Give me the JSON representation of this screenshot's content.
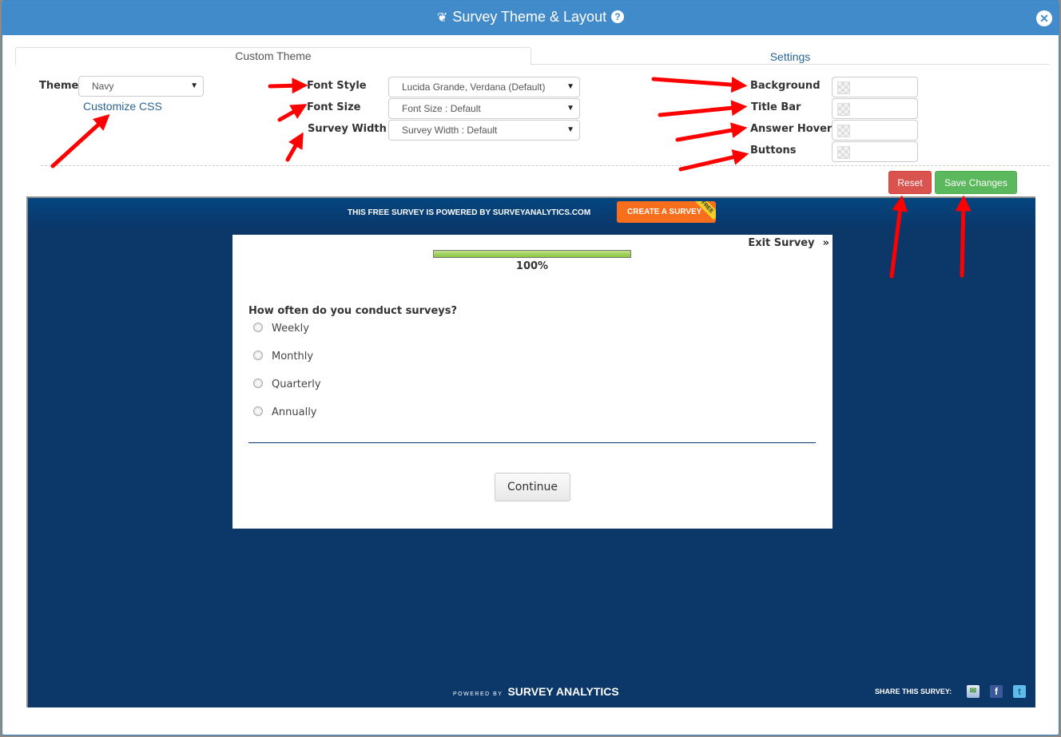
{
  "dialog": {
    "title": "Survey Theme & Layout",
    "title_icon": "leaf-icon",
    "help_icon": "question-circle-icon",
    "close_icon": "close-circle-icon"
  },
  "tabs": [
    {
      "label": "Custom Theme",
      "active": true
    },
    {
      "label": "Settings",
      "active": false
    }
  ],
  "theme": {
    "label": "Theme",
    "value": "Navy",
    "customize_link": "Customize CSS"
  },
  "fonts": {
    "font_style_label": "Font Style",
    "font_style_value": "Lucida Grande, Verdana (Default)",
    "font_size_label": "Font Size",
    "font_size_value": "Font Size : Default",
    "survey_width_label": "Survey Width",
    "survey_width_value": "Survey Width : Default"
  },
  "colors": {
    "background_label": "Background",
    "title_bar_label": "Title Bar",
    "answer_hover_label": "Answer Hover",
    "buttons_label": "Buttons"
  },
  "actions": {
    "reset": "Reset",
    "save": "Save Changes"
  },
  "preview": {
    "promo_text": "THIS FREE SURVEY IS POWERED BY SURVEYANALYTICS.COM",
    "create_button": "CREATE A SURVEY",
    "create_ribbon": "FREE",
    "exit_label": "Exit Survey",
    "exit_chevron": "»",
    "progress_percent": 100,
    "progress_label": "100%",
    "question": "How often do you conduct surveys?",
    "options": [
      "Weekly",
      "Monthly",
      "Quarterly",
      "Annually"
    ],
    "continue_button": "Continue",
    "powered_small": "POWERED BY",
    "powered_brand": "SURVEY ANALYTICS",
    "share_label": "SHARE THIS SURVEY:"
  },
  "accent_colors": {
    "titlebar": "#428bca",
    "reset": "#d9534f",
    "save": "#5cb85c",
    "preview_bg": "#0c3769",
    "create_button": "#f76f1c",
    "annotation_arrow": "#ff0000"
  }
}
